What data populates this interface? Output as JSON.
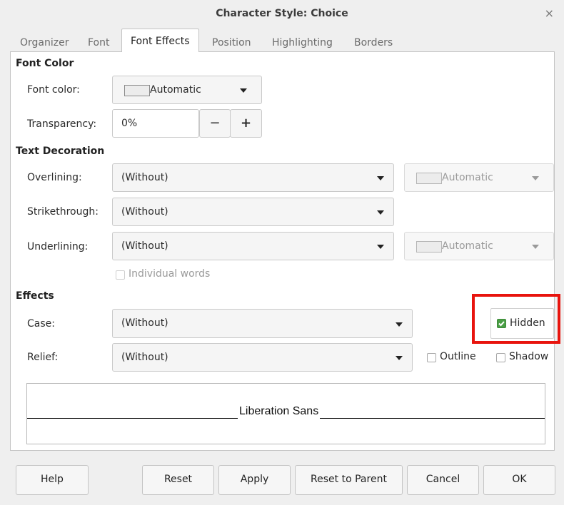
{
  "window": {
    "title": "Character Style: Choice",
    "close_glyph": "×"
  },
  "tabs": [
    {
      "label": "Organizer"
    },
    {
      "label": "Font"
    },
    {
      "label": "Font Effects"
    },
    {
      "label": "Position"
    },
    {
      "label": "Highlighting"
    },
    {
      "label": "Borders"
    }
  ],
  "font_color": {
    "heading": "Font Color",
    "color_label": "Font color:",
    "color_value": "Automatic",
    "transparency_label": "Transparency:",
    "transparency_value": "0%",
    "minus": "−",
    "plus": "+"
  },
  "text_decoration": {
    "heading": "Text Decoration",
    "overlining_label": "Overlining:",
    "overlining_value": "(Without)",
    "overlining_color": "Automatic",
    "strikethrough_label": "Strikethrough:",
    "strikethrough_value": "(Without)",
    "underlining_label": "Underlining:",
    "underlining_value": "(Without)",
    "underlining_color": "Automatic",
    "individual_words": "Individual words"
  },
  "effects": {
    "heading": "Effects",
    "case_label": "Case:",
    "case_value": "(Without)",
    "relief_label": "Relief:",
    "relief_value": "(Without)",
    "hidden": "Hidden",
    "outline": "Outline",
    "shadow": "Shadow"
  },
  "preview": {
    "text": "Liberation Sans"
  },
  "buttons": {
    "help": "Help",
    "reset": "Reset",
    "apply": "Apply",
    "reset_to_parent": "Reset to Parent",
    "cancel": "Cancel",
    "ok": "OK"
  },
  "colors": {
    "highlight_box": "#e8140e",
    "checkbox_checked": "#4a9e45"
  }
}
